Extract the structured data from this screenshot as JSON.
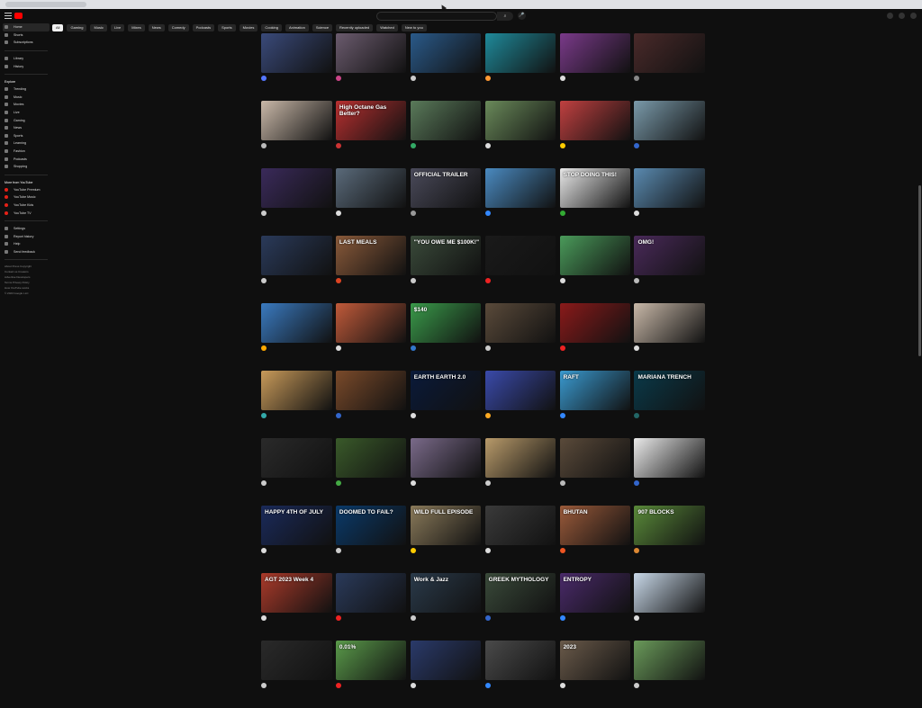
{
  "window": {
    "title": "YouTube"
  },
  "logo": {
    "text": ""
  },
  "search": {
    "placeholder": "",
    "value": "",
    "button": "⌕",
    "mic": "🎤"
  },
  "chips": [
    "All",
    "Gaming",
    "Music",
    "Live",
    "Mixes",
    "News",
    "Comedy",
    "Podcasts",
    "Sports",
    "Movies",
    "Cooking",
    "Animation",
    "Science",
    "Recently uploaded",
    "Watched",
    "New to you"
  ],
  "sidebar": {
    "primary": [
      "Home",
      "Shorts",
      "Subscriptions"
    ],
    "you": [
      "Library",
      "History"
    ],
    "explore_head": "Explore",
    "explore": [
      "Trending",
      "Music",
      "Movies",
      "Live",
      "Gaming",
      "News",
      "Sports",
      "Learning",
      "Fashion",
      "Podcasts",
      "Shopping"
    ],
    "more_head": "More from YouTube",
    "more": [
      "YouTube Premium",
      "YouTube Music",
      "YouTube Kids",
      "YouTube TV"
    ],
    "settings": [
      "Settings",
      "Report history",
      "Help",
      "Send feedback"
    ],
    "footer": [
      "About Press Copyright",
      "Contact us Creators",
      "Advertise Developers",
      "Terms Privacy Policy",
      "How YouTube works",
      "© 2023 Google LLC"
    ]
  },
  "colors": {
    "background": "#0f0f0f",
    "accent": "#ff0000"
  },
  "videos": [
    [
      {
        "overlay": "",
        "thumb": "#3a4a7a",
        "av": "#5577ff",
        "title": "",
        "channel": ""
      },
      {
        "overlay": "",
        "thumb": "#6b5b6e",
        "av": "#cc4488",
        "title": "",
        "channel": ""
      },
      {
        "overlay": "",
        "thumb": "#2a5a8a",
        "av": "#cccccc",
        "title": "",
        "channel": ""
      },
      {
        "overlay": "",
        "thumb": "#1f8a9a",
        "av": "#ff9933",
        "title": "",
        "channel": ""
      },
      {
        "overlay": "",
        "thumb": "#7a3a8a",
        "av": "#dddddd",
        "title": "",
        "channel": ""
      },
      {
        "overlay": "",
        "thumb": "#4a2a2a",
        "av": "#888888",
        "title": "",
        "channel": ""
      }
    ],
    [
      {
        "overlay": "",
        "thumb": "#c9b8a8",
        "av": "#bbbbbb",
        "title": "",
        "channel": ""
      },
      {
        "overlay": "High Octane Gas Better?",
        "thumb": "#b83030",
        "av": "#cc3333",
        "title": "",
        "channel": ""
      },
      {
        "overlay": "",
        "thumb": "#5a7a5a",
        "av": "#33aa66",
        "title": "",
        "channel": ""
      },
      {
        "overlay": "",
        "thumb": "#6a8a5a",
        "av": "#dddddd",
        "title": "",
        "channel": ""
      },
      {
        "overlay": "",
        "thumb": "#c04040",
        "av": "#ffcc00",
        "title": "",
        "channel": ""
      },
      {
        "overlay": "",
        "thumb": "#7a9aaa",
        "av": "#3366cc",
        "title": "",
        "channel": ""
      }
    ],
    [
      {
        "overlay": "",
        "thumb": "#3a2a5a",
        "av": "#cccccc",
        "title": "",
        "channel": ""
      },
      {
        "overlay": "",
        "thumb": "#5a6a7a",
        "av": "#dddddd",
        "title": "",
        "channel": ""
      },
      {
        "overlay": "OFFICIAL TRAILER",
        "thumb": "#4a4a5a",
        "av": "#999999",
        "title": "",
        "channel": ""
      },
      {
        "overlay": "",
        "thumb": "#4a8ac0",
        "av": "#3388ff",
        "title": "",
        "channel": ""
      },
      {
        "overlay": "STOP DOING THIS!",
        "thumb": "#e8e8e8",
        "av": "#33aa33",
        "title": "",
        "channel": ""
      },
      {
        "overlay": "",
        "thumb": "#5a8ab0",
        "av": "#dddddd",
        "title": "",
        "channel": ""
      }
    ],
    [
      {
        "overlay": "",
        "thumb": "#2a3a5a",
        "av": "#cccccc",
        "title": "",
        "channel": ""
      },
      {
        "overlay": "LAST MEALS",
        "thumb": "#8a5a3a",
        "av": "#dd4422",
        "title": "",
        "channel": ""
      },
      {
        "overlay": "\"YOU OWE ME $100K!\"",
        "thumb": "#3a4a3a",
        "av": "#cccccc",
        "title": "",
        "channel": ""
      },
      {
        "overlay": "",
        "thumb": "#1a1a1a",
        "av": "#ee2222",
        "title": "",
        "channel": ""
      },
      {
        "overlay": "",
        "thumb": "#4a9a5a",
        "av": "#dddddd",
        "title": "",
        "channel": ""
      },
      {
        "overlay": "OMG!",
        "thumb": "#4a2a5a",
        "av": "#bbbbbb",
        "title": "",
        "channel": ""
      }
    ],
    [
      {
        "overlay": "",
        "thumb": "#3a7ac0",
        "av": "#ffaa00",
        "title": "",
        "channel": ""
      },
      {
        "overlay": "",
        "thumb": "#c05a3a",
        "av": "#dddddd",
        "title": "",
        "channel": ""
      },
      {
        "overlay": "$140",
        "thumb": "#3a9a4a",
        "av": "#3377cc",
        "title": "",
        "channel": ""
      },
      {
        "overlay": "",
        "thumb": "#5a4a3a",
        "av": "#cccccc",
        "title": "",
        "channel": ""
      },
      {
        "overlay": "",
        "thumb": "#8a1a1a",
        "av": "#ee2222",
        "title": "",
        "channel": ""
      },
      {
        "overlay": "",
        "thumb": "#c8b8a8",
        "av": "#dddddd",
        "title": "",
        "channel": ""
      }
    ],
    [
      {
        "overlay": "",
        "thumb": "#c89a5a",
        "av": "#33aaaa",
        "title": "",
        "channel": ""
      },
      {
        "overlay": "",
        "thumb": "#7a4a2a",
        "av": "#3366cc",
        "title": "",
        "channel": ""
      },
      {
        "overlay": "EARTH  EARTH 2.0",
        "thumb": "#0a1a3a",
        "av": "#dddddd",
        "title": "",
        "channel": ""
      },
      {
        "overlay": "",
        "thumb": "#3a4aaa",
        "av": "#ffaa22",
        "title": "",
        "channel": ""
      },
      {
        "overlay": "RAFT",
        "thumb": "#3a9ad0",
        "av": "#3388ff",
        "title": "",
        "channel": ""
      },
      {
        "overlay": "MARIANA TRENCH",
        "thumb": "#0a3a4a",
        "av": "#226666",
        "title": "",
        "channel": ""
      }
    ],
    [
      {
        "overlay": "",
        "thumb": "#2a2a2a",
        "av": "#cccccc",
        "title": "",
        "channel": ""
      },
      {
        "overlay": "",
        "thumb": "#3a5a2a",
        "av": "#44aa44",
        "title": "",
        "channel": ""
      },
      {
        "overlay": "",
        "thumb": "#7a6a8a",
        "av": "#dddddd",
        "title": "",
        "channel": ""
      },
      {
        "overlay": "",
        "thumb": "#b89a6a",
        "av": "#cccccc",
        "title": "",
        "channel": ""
      },
      {
        "overlay": "",
        "thumb": "#5a4a3a",
        "av": "#bbbbbb",
        "title": "",
        "channel": ""
      },
      {
        "overlay": "",
        "thumb": "#eaeaea",
        "av": "#3366cc",
        "title": "",
        "channel": ""
      }
    ],
    [
      {
        "overlay": "HAPPY 4TH OF JULY",
        "thumb": "#1a2a5a",
        "av": "#dddddd",
        "title": "",
        "channel": ""
      },
      {
        "overlay": "DOOMED TO FAIL?",
        "thumb": "#0a3a6a",
        "av": "#cccccc",
        "title": "",
        "channel": ""
      },
      {
        "overlay": "WILD  FULL EPISODE",
        "thumb": "#8a7a5a",
        "av": "#ffcc00",
        "title": "",
        "channel": ""
      },
      {
        "overlay": "",
        "thumb": "#3a3a3a",
        "av": "#dddddd",
        "title": "",
        "channel": ""
      },
      {
        "overlay": "BHUTAN",
        "thumb": "#9a5a3a",
        "av": "#ee5522",
        "title": "",
        "channel": ""
      },
      {
        "overlay": "907 BLOCKS",
        "thumb": "#5a8a3a",
        "av": "#dd8833",
        "title": "",
        "channel": ""
      }
    ],
    [
      {
        "overlay": "AGT 2023 Week 4",
        "thumb": "#aa3a2a",
        "av": "#dddddd",
        "title": "",
        "channel": ""
      },
      {
        "overlay": "",
        "thumb": "#2a3a5a",
        "av": "#ee2222",
        "title": "",
        "channel": ""
      },
      {
        "overlay": "Work & Jazz",
        "thumb": "#2a3a4a",
        "av": "#cccccc",
        "title": "",
        "channel": ""
      },
      {
        "overlay": "GREEK MYTHOLOGY",
        "thumb": "#3a4a3a",
        "av": "#3366cc",
        "title": "",
        "channel": ""
      },
      {
        "overlay": "ENTROPY",
        "thumb": "#4a2a6a",
        "av": "#3388ff",
        "title": "",
        "channel": ""
      },
      {
        "overlay": "",
        "thumb": "#c8d8e8",
        "av": "#dddddd",
        "title": "",
        "channel": ""
      }
    ],
    [
      {
        "overlay": "",
        "thumb": "#2a2a2a",
        "av": "#cccccc",
        "title": "",
        "channel": ""
      },
      {
        "overlay": "0.01%",
        "thumb": "#5a9a4a",
        "av": "#ee2222",
        "title": "",
        "channel": ""
      },
      {
        "overlay": "",
        "thumb": "#2a3a6a",
        "av": "#dddddd",
        "title": "",
        "channel": ""
      },
      {
        "overlay": "",
        "thumb": "#4a4a4a",
        "av": "#3388ff",
        "title": "",
        "channel": ""
      },
      {
        "overlay": "2023",
        "thumb": "#6a5a4a",
        "av": "#dddddd",
        "title": "",
        "channel": ""
      },
      {
        "overlay": "",
        "thumb": "#6a9a5a",
        "av": "#cccccc",
        "title": "",
        "channel": ""
      }
    ]
  ]
}
